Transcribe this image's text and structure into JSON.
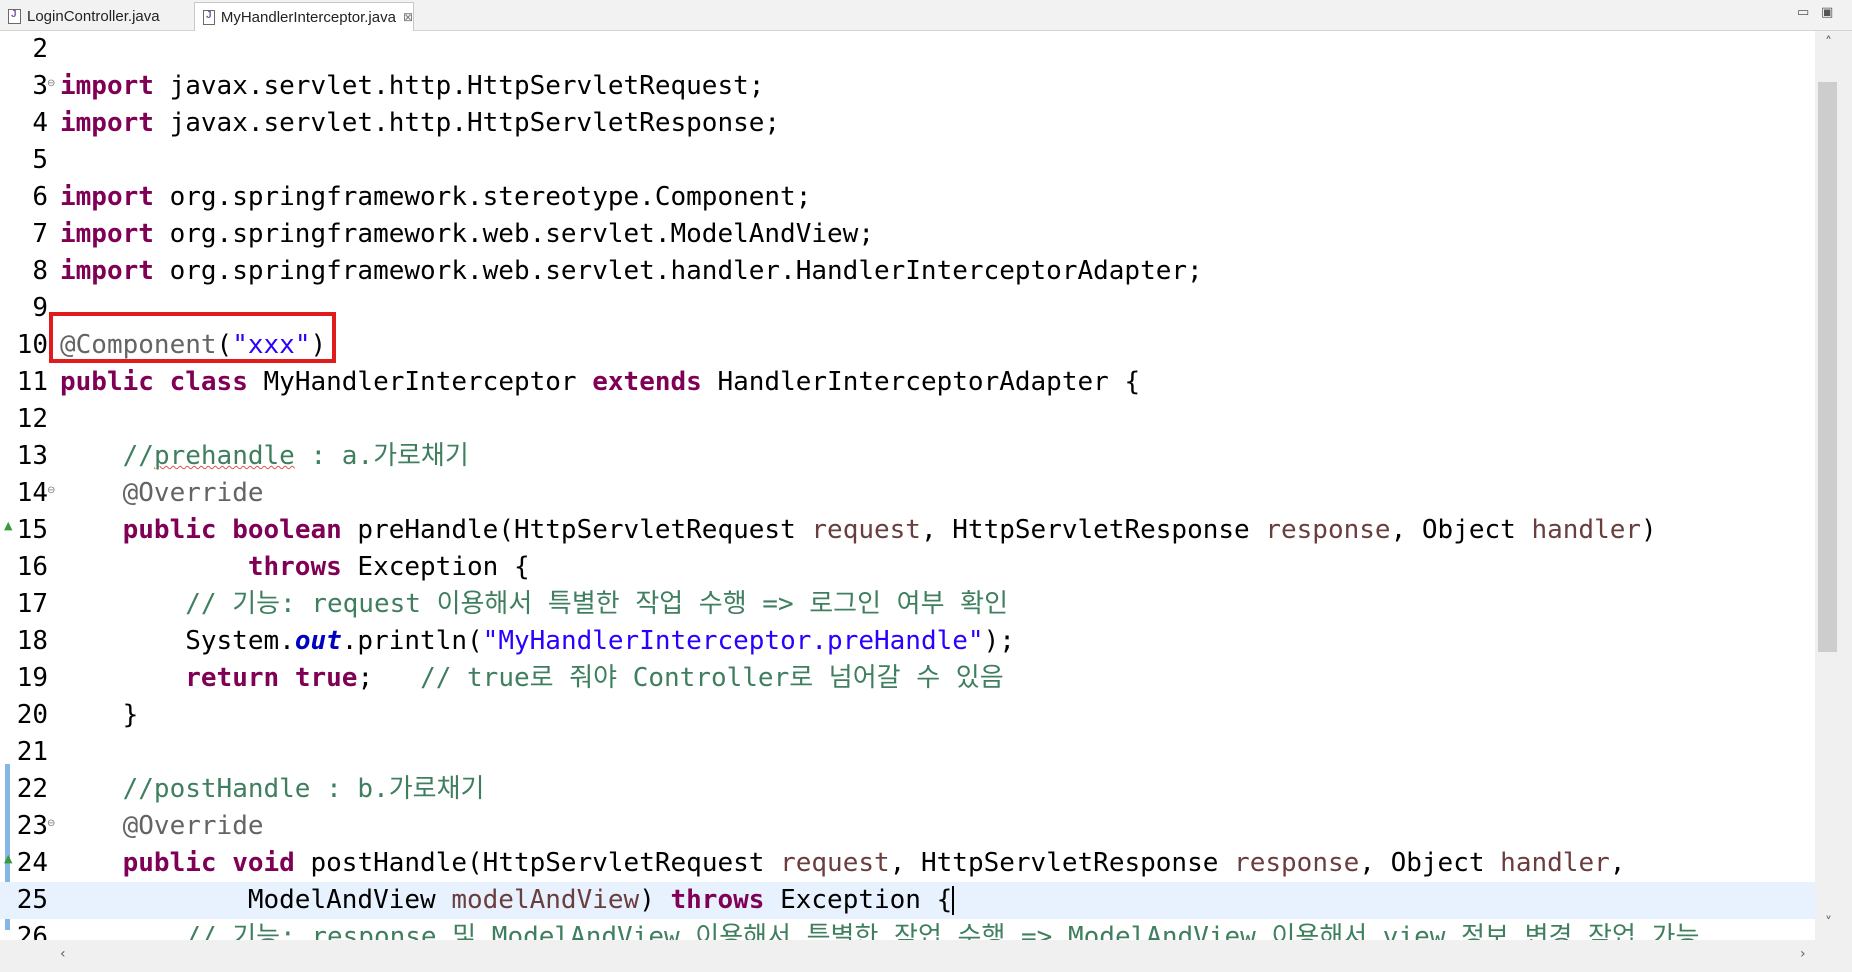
{
  "tabs": [
    {
      "label": "LoginController.java",
      "active": false
    },
    {
      "label": "MyHandlerInterceptor.java",
      "active": true
    }
  ],
  "tab_close_glyph": "⊠",
  "window_buttons": [
    "▭",
    "▣"
  ],
  "code_lines": [
    {
      "num": "2",
      "segments": []
    },
    {
      "num": "3",
      "fold": true,
      "segments": [
        {
          "t": "import",
          "c": "kw"
        },
        {
          "t": " javax.servlet.http.HttpServletRequest;"
        }
      ]
    },
    {
      "num": "4",
      "segments": [
        {
          "t": "import",
          "c": "kw"
        },
        {
          "t": " javax.servlet.http.HttpServletResponse;"
        }
      ]
    },
    {
      "num": "5",
      "segments": []
    },
    {
      "num": "6",
      "segments": [
        {
          "t": "import",
          "c": "kw"
        },
        {
          "t": " org.springframework.stereotype.Component;"
        }
      ]
    },
    {
      "num": "7",
      "segments": [
        {
          "t": "import",
          "c": "kw"
        },
        {
          "t": " org.springframework.web.servlet.ModelAndView;"
        }
      ]
    },
    {
      "num": "8",
      "segments": [
        {
          "t": "import",
          "c": "kw"
        },
        {
          "t": " org.springframework.web.servlet.handler.HandlerInterceptorAdapter;"
        }
      ]
    },
    {
      "num": "9",
      "segments": []
    },
    {
      "num": "10",
      "segments": [
        {
          "t": "@Component",
          "c": "an"
        },
        {
          "t": "("
        },
        {
          "t": "\"xxx\"",
          "c": "st"
        },
        {
          "t": ")"
        }
      ]
    },
    {
      "num": "11",
      "segments": [
        {
          "t": "public",
          "c": "kw"
        },
        {
          "t": " "
        },
        {
          "t": "class",
          "c": "kw"
        },
        {
          "t": " MyHandlerInterceptor "
        },
        {
          "t": "extends",
          "c": "kw"
        },
        {
          "t": " HandlerInterceptorAdapter {"
        }
      ]
    },
    {
      "num": "12",
      "segments": []
    },
    {
      "num": "13",
      "segments": [
        {
          "t": "    "
        },
        {
          "t": "//",
          "c": "cm"
        },
        {
          "t": "prehandle",
          "c": "cm sq"
        },
        {
          "t": " : a.가로채기",
          "c": "cm"
        }
      ]
    },
    {
      "num": "14",
      "fold": true,
      "segments": [
        {
          "t": "    "
        },
        {
          "t": "@Override",
          "c": "an"
        }
      ]
    },
    {
      "num": "15",
      "override": true,
      "segments": [
        {
          "t": "    "
        },
        {
          "t": "public",
          "c": "kw"
        },
        {
          "t": " "
        },
        {
          "t": "boolean",
          "c": "kw"
        },
        {
          "t": " preHandle(HttpServletRequest "
        },
        {
          "t": "request",
          "c": "pa"
        },
        {
          "t": ", HttpServletResponse "
        },
        {
          "t": "response",
          "c": "pa"
        },
        {
          "t": ", Object "
        },
        {
          "t": "handler",
          "c": "pa"
        },
        {
          "t": ")"
        }
      ]
    },
    {
      "num": "16",
      "segments": [
        {
          "t": "            "
        },
        {
          "t": "throws",
          "c": "kw"
        },
        {
          "t": " Exception {"
        }
      ]
    },
    {
      "num": "17",
      "segments": [
        {
          "t": "        "
        },
        {
          "t": "// 기능: request 이용해서 특별한 작업 수행 => 로그인 여부 확인",
          "c": "cm"
        }
      ]
    },
    {
      "num": "18",
      "segments": [
        {
          "t": "        System."
        },
        {
          "t": "out",
          "c": "fi"
        },
        {
          "t": ".println("
        },
        {
          "t": "\"MyHandlerInterceptor.preHandle\"",
          "c": "st"
        },
        {
          "t": ");"
        }
      ]
    },
    {
      "num": "19",
      "segments": [
        {
          "t": "        "
        },
        {
          "t": "return",
          "c": "kw"
        },
        {
          "t": " "
        },
        {
          "t": "true",
          "c": "kw"
        },
        {
          "t": ";   "
        },
        {
          "t": "// true로 줘야 Controller로 넘어갈 수 있음",
          "c": "cm"
        }
      ]
    },
    {
      "num": "20",
      "segments": [
        {
          "t": "    }"
        }
      ]
    },
    {
      "num": "21",
      "segments": []
    },
    {
      "num": "22",
      "segments": [
        {
          "t": "    "
        },
        {
          "t": "//postHandle : b.가로채기",
          "c": "cm"
        }
      ]
    },
    {
      "num": "23",
      "fold": true,
      "segments": [
        {
          "t": "    "
        },
        {
          "t": "@Override",
          "c": "an"
        }
      ]
    },
    {
      "num": "24",
      "override": true,
      "segments": [
        {
          "t": "    "
        },
        {
          "t": "public",
          "c": "kw"
        },
        {
          "t": " "
        },
        {
          "t": "void",
          "c": "kw"
        },
        {
          "t": " postHandle(HttpServletRequest "
        },
        {
          "t": "request",
          "c": "pa"
        },
        {
          "t": ", HttpServletResponse "
        },
        {
          "t": "response",
          "c": "pa"
        },
        {
          "t": ", Object "
        },
        {
          "t": "handler",
          "c": "pa"
        },
        {
          "t": ","
        }
      ]
    },
    {
      "num": "25",
      "current": true,
      "segments": [
        {
          "t": "            ModelAndView "
        },
        {
          "t": "modelAndView",
          "c": "pa"
        },
        {
          "t": ") "
        },
        {
          "t": "throws",
          "c": "kw"
        },
        {
          "t": " Exception {"
        }
      ]
    },
    {
      "num": "26",
      "segments": [
        {
          "t": "        "
        },
        {
          "t": "// 기능: response 및 ModelAndView 이용해서 특별한 작업 수행 => ModelAndView 이용해서 view 정보 변경 작업 가능",
          "c": "cm"
        }
      ]
    }
  ],
  "colors": {
    "keyword": "#7f0055",
    "comment": "#3f7f5f",
    "string": "#2a00ff",
    "annotation": "#646464",
    "parameter": "#6a3e3e",
    "highlight_box": "#e01b1b",
    "current_line": "#e8f2fe"
  }
}
